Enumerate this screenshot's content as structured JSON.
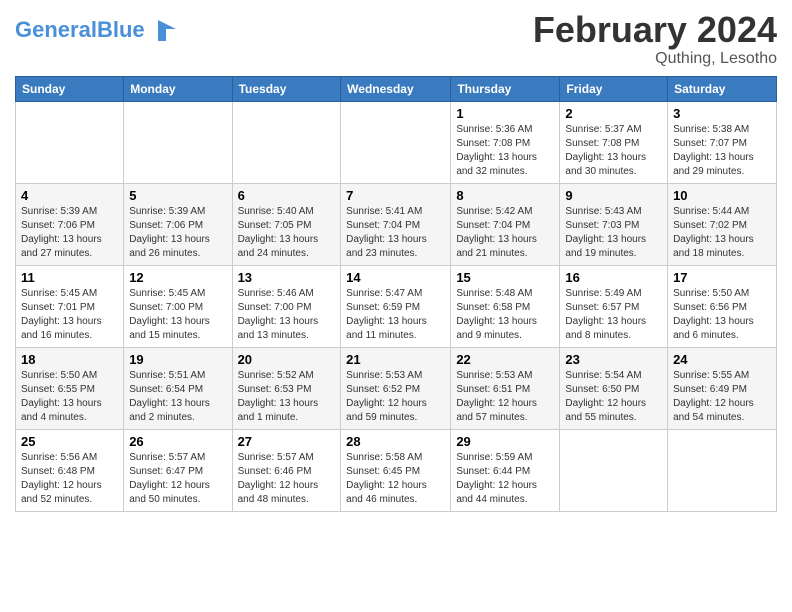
{
  "header": {
    "logo_text_general": "General",
    "logo_text_blue": "Blue",
    "month_year": "February 2024",
    "location": "Quthing, Lesotho"
  },
  "days_of_week": [
    "Sunday",
    "Monday",
    "Tuesday",
    "Wednesday",
    "Thursday",
    "Friday",
    "Saturday"
  ],
  "weeks": [
    [
      {
        "day": "",
        "info": ""
      },
      {
        "day": "",
        "info": ""
      },
      {
        "day": "",
        "info": ""
      },
      {
        "day": "",
        "info": ""
      },
      {
        "day": "1",
        "info": "Sunrise: 5:36 AM\nSunset: 7:08 PM\nDaylight: 13 hours\nand 32 minutes."
      },
      {
        "day": "2",
        "info": "Sunrise: 5:37 AM\nSunset: 7:08 PM\nDaylight: 13 hours\nand 30 minutes."
      },
      {
        "day": "3",
        "info": "Sunrise: 5:38 AM\nSunset: 7:07 PM\nDaylight: 13 hours\nand 29 minutes."
      }
    ],
    [
      {
        "day": "4",
        "info": "Sunrise: 5:39 AM\nSunset: 7:06 PM\nDaylight: 13 hours\nand 27 minutes."
      },
      {
        "day": "5",
        "info": "Sunrise: 5:39 AM\nSunset: 7:06 PM\nDaylight: 13 hours\nand 26 minutes."
      },
      {
        "day": "6",
        "info": "Sunrise: 5:40 AM\nSunset: 7:05 PM\nDaylight: 13 hours\nand 24 minutes."
      },
      {
        "day": "7",
        "info": "Sunrise: 5:41 AM\nSunset: 7:04 PM\nDaylight: 13 hours\nand 23 minutes."
      },
      {
        "day": "8",
        "info": "Sunrise: 5:42 AM\nSunset: 7:04 PM\nDaylight: 13 hours\nand 21 minutes."
      },
      {
        "day": "9",
        "info": "Sunrise: 5:43 AM\nSunset: 7:03 PM\nDaylight: 13 hours\nand 19 minutes."
      },
      {
        "day": "10",
        "info": "Sunrise: 5:44 AM\nSunset: 7:02 PM\nDaylight: 13 hours\nand 18 minutes."
      }
    ],
    [
      {
        "day": "11",
        "info": "Sunrise: 5:45 AM\nSunset: 7:01 PM\nDaylight: 13 hours\nand 16 minutes."
      },
      {
        "day": "12",
        "info": "Sunrise: 5:45 AM\nSunset: 7:00 PM\nDaylight: 13 hours\nand 15 minutes."
      },
      {
        "day": "13",
        "info": "Sunrise: 5:46 AM\nSunset: 7:00 PM\nDaylight: 13 hours\nand 13 minutes."
      },
      {
        "day": "14",
        "info": "Sunrise: 5:47 AM\nSunset: 6:59 PM\nDaylight: 13 hours\nand 11 minutes."
      },
      {
        "day": "15",
        "info": "Sunrise: 5:48 AM\nSunset: 6:58 PM\nDaylight: 13 hours\nand 9 minutes."
      },
      {
        "day": "16",
        "info": "Sunrise: 5:49 AM\nSunset: 6:57 PM\nDaylight: 13 hours\nand 8 minutes."
      },
      {
        "day": "17",
        "info": "Sunrise: 5:50 AM\nSunset: 6:56 PM\nDaylight: 13 hours\nand 6 minutes."
      }
    ],
    [
      {
        "day": "18",
        "info": "Sunrise: 5:50 AM\nSunset: 6:55 PM\nDaylight: 13 hours\nand 4 minutes."
      },
      {
        "day": "19",
        "info": "Sunrise: 5:51 AM\nSunset: 6:54 PM\nDaylight: 13 hours\nand 2 minutes."
      },
      {
        "day": "20",
        "info": "Sunrise: 5:52 AM\nSunset: 6:53 PM\nDaylight: 13 hours\nand 1 minute."
      },
      {
        "day": "21",
        "info": "Sunrise: 5:53 AM\nSunset: 6:52 PM\nDaylight: 12 hours\nand 59 minutes."
      },
      {
        "day": "22",
        "info": "Sunrise: 5:53 AM\nSunset: 6:51 PM\nDaylight: 12 hours\nand 57 minutes."
      },
      {
        "day": "23",
        "info": "Sunrise: 5:54 AM\nSunset: 6:50 PM\nDaylight: 12 hours\nand 55 minutes."
      },
      {
        "day": "24",
        "info": "Sunrise: 5:55 AM\nSunset: 6:49 PM\nDaylight: 12 hours\nand 54 minutes."
      }
    ],
    [
      {
        "day": "25",
        "info": "Sunrise: 5:56 AM\nSunset: 6:48 PM\nDaylight: 12 hours\nand 52 minutes."
      },
      {
        "day": "26",
        "info": "Sunrise: 5:57 AM\nSunset: 6:47 PM\nDaylight: 12 hours\nand 50 minutes."
      },
      {
        "day": "27",
        "info": "Sunrise: 5:57 AM\nSunset: 6:46 PM\nDaylight: 12 hours\nand 48 minutes."
      },
      {
        "day": "28",
        "info": "Sunrise: 5:58 AM\nSunset: 6:45 PM\nDaylight: 12 hours\nand 46 minutes."
      },
      {
        "day": "29",
        "info": "Sunrise: 5:59 AM\nSunset: 6:44 PM\nDaylight: 12 hours\nand 44 minutes."
      },
      {
        "day": "",
        "info": ""
      },
      {
        "day": "",
        "info": ""
      }
    ]
  ]
}
